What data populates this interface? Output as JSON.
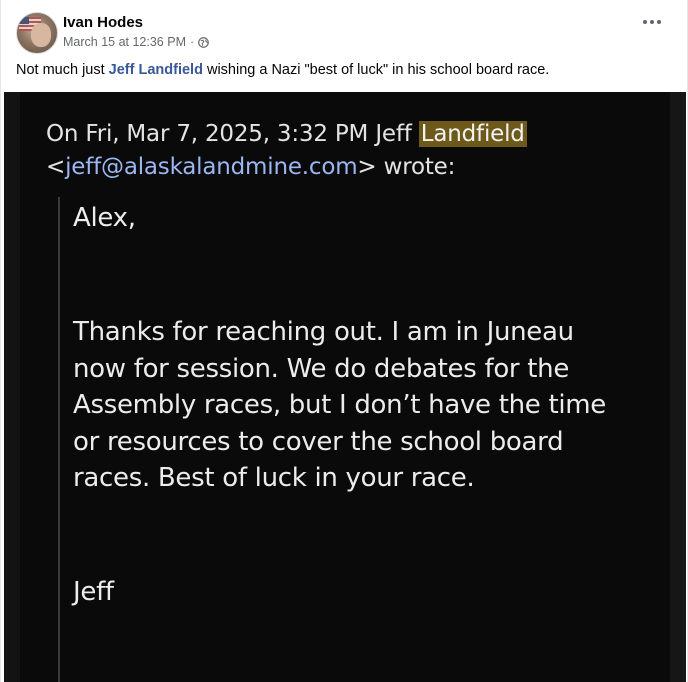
{
  "post": {
    "author": "Ivan Hodes",
    "timestamp": "March 15 at 12:36 PM",
    "separator": "·",
    "audience_icon": "globe-icon",
    "more_icon": "more-options-icon",
    "caption_before": "Not much just ",
    "caption_link": "Jeff Landfield",
    "caption_after": " wishing a Nazi \"best of luck\" in his school board race.",
    "link_color": "#385898"
  },
  "email": {
    "header_line1_before": "On Fri, Mar 7, 2025, 3:32 PM Jeff ",
    "header_highlight": "Landfield",
    "header_line2_open": "<",
    "header_email": "jeff@alaskalandmine.com",
    "header_line2_close": "> wrote:",
    "greeting": "Alex,",
    "body_lines": [
      "Thanks for reaching out. I am in Juneau",
      "now for session. We do debates for the",
      "Assembly races, but I don’t have the time",
      "or resources to cover the school board",
      "races. Best of luck in your race."
    ],
    "signature": "Jeff",
    "highlight_color": "#6d5a1a",
    "email_color": "#9bb6f0"
  }
}
